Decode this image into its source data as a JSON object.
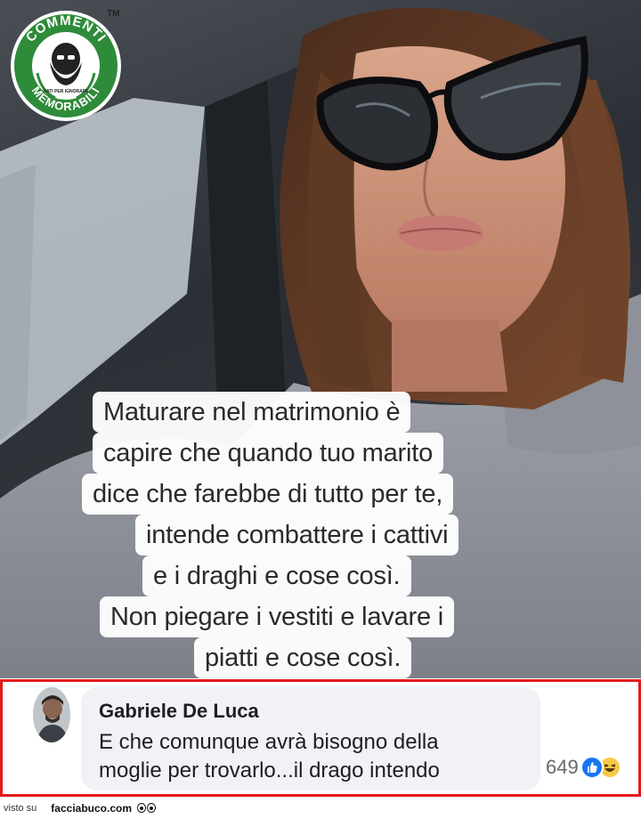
{
  "logo": {
    "top_text": "COMMENTI",
    "bottom_text": "MEMORABILI",
    "badge_text": "NATI PER IGNORARE",
    "trademark": "TM",
    "color": "#2e8b3a"
  },
  "caption": {
    "lines": [
      "Maturare nel matrimonio è",
      "capire che quando tuo marito",
      "dice che farebbe di tutto per te,",
      "intende combattere i cattivi",
      "e i draghi e cose così.",
      "Non piegare i vestiti e lavare i",
      "piatti e cose così."
    ]
  },
  "comment": {
    "author": "Gabriele De Luca",
    "text_line1": "E che comunque avrà bisogno della",
    "text_line2": "moglie per trovarlo...il drago intendo",
    "reaction_count": "649",
    "reactions": [
      "like-icon",
      "haha-icon"
    ],
    "border_color": "#e21b1b"
  },
  "footer": {
    "visto": "visto su",
    "site": "facciabuco.com"
  }
}
